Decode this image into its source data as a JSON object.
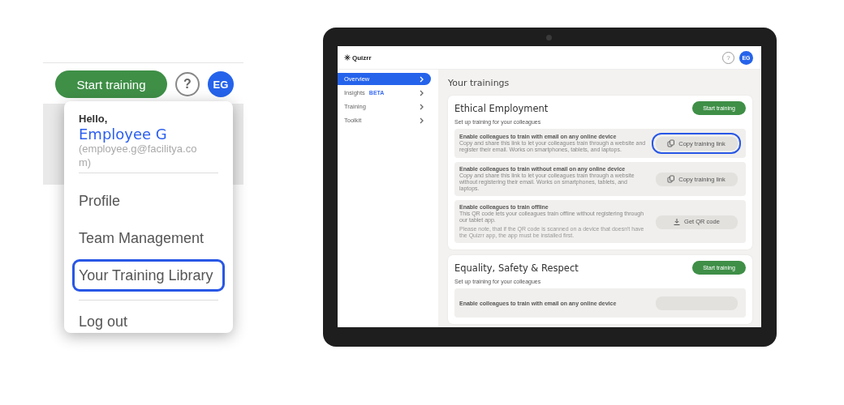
{
  "zoom_panel": {
    "start_button": "Start training",
    "help": "?",
    "avatar": "EG",
    "menu": {
      "greeting": "Hello,",
      "name": "Employee G",
      "email": "(employee.g@facilitya.com)",
      "items": [
        {
          "label": "Profile",
          "highlighted": false
        },
        {
          "label": "Team Management",
          "highlighted": false
        },
        {
          "label": "Your Training Library",
          "highlighted": true
        },
        {
          "label": "Log out",
          "highlighted": false
        }
      ]
    }
  },
  "tablet": {
    "logo": "Quizrr",
    "help": "?",
    "avatar": "EG",
    "sidebar": [
      {
        "label": "Overview",
        "selected": true
      },
      {
        "label": "Insights",
        "badge": "BETA",
        "selected": false
      },
      {
        "label": "Training",
        "selected": false
      },
      {
        "label": "Toolkit",
        "selected": false
      }
    ],
    "heading": "Your trainings",
    "trainings": [
      {
        "title": "Ethical Employment",
        "start_button": "Start training",
        "subtitle": "Set up training for your colleagues",
        "options": [
          {
            "title": "Enable colleagues to train with email on any online device",
            "description": "Copy and share this link to let your colleagues train through a website and register their email. Works on smartphones, tablets, and laptops.",
            "button": {
              "kind": "copy",
              "label": "Copy training link"
            },
            "highlighted": true
          },
          {
            "title": "Enable colleagues to train without email on any online device",
            "description": "Copy and share this link to let your colleagues train through a website without registering their email. Works on smartphones, tablets, and laptops.",
            "button": {
              "kind": "copy",
              "label": "Copy training link"
            },
            "highlighted": false
          },
          {
            "title": "Enable colleagues to train offline",
            "description": "This QR code lets your colleagues train offline without registering through our tablet app.",
            "note": "Please note, that if the QR code is scanned on a device that doesn't have the Quizrr app, the app must be installed first.",
            "button": {
              "kind": "download",
              "label": "Get QR code"
            },
            "highlighted": false
          }
        ]
      },
      {
        "title": "Equality, Safety & Respect",
        "start_button": "Start training",
        "subtitle": "Set up training for your colleagues",
        "options": [
          {
            "title": "Enable colleagues to train with email on any online device",
            "button": {
              "kind": "copy"
            },
            "highlighted": false
          }
        ]
      }
    ]
  }
}
